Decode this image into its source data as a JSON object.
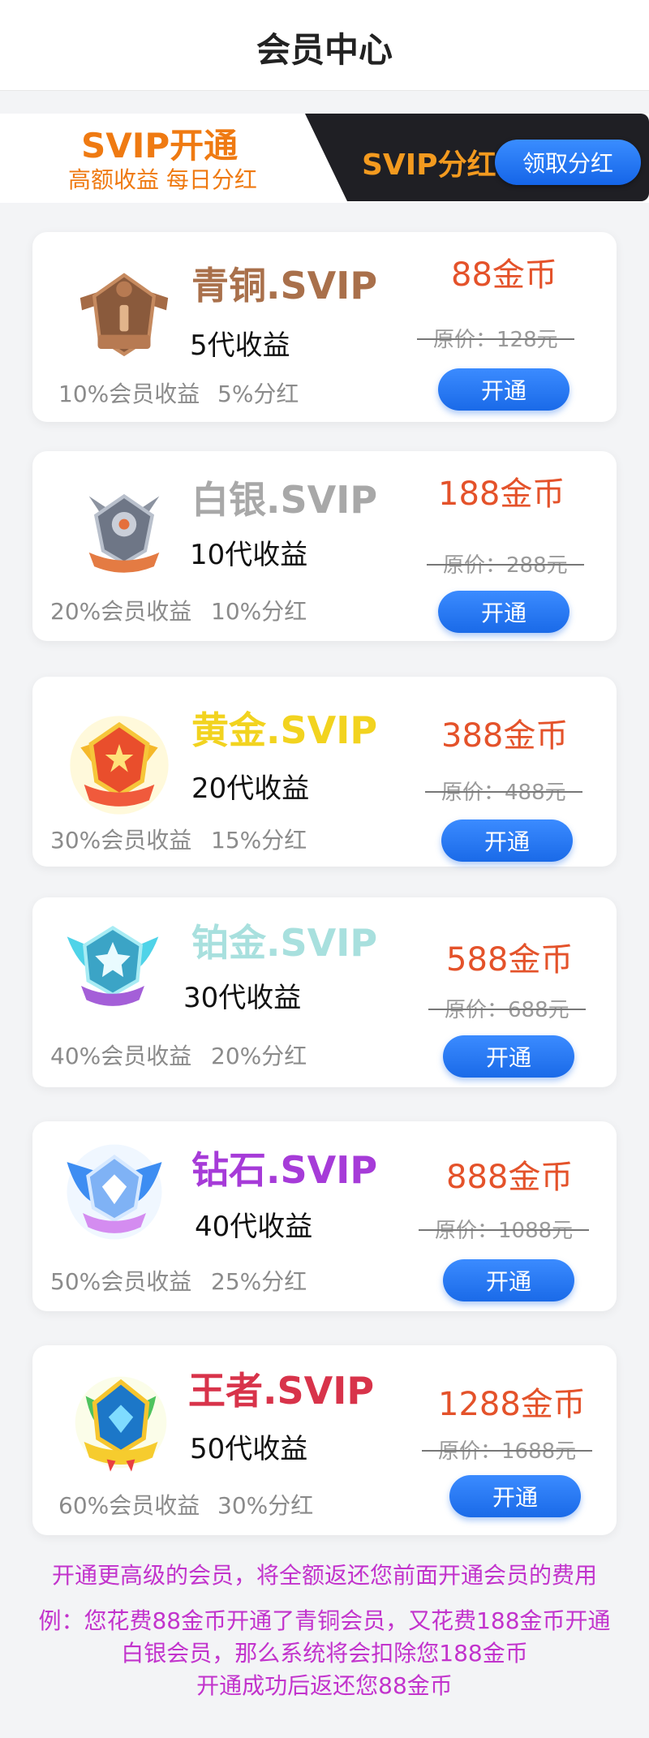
{
  "header": {
    "title": "会员中心"
  },
  "banner": {
    "title": "SVIP开通",
    "subtitle": "高额收益 每日分红",
    "dividend_label": "SVIP分红",
    "claim_button": "领取分红"
  },
  "tiers": [
    {
      "name": "青铜.SVIP",
      "generations": "5代收益",
      "member_income": "10%会员收益",
      "dividend": "5%分红",
      "price": "88金币",
      "original_price": "原价：128元",
      "open_button": "开通",
      "name_color": "#a9704b",
      "badge": "bronze-badge-icon"
    },
    {
      "name": "白银.SVIP",
      "generations": "10代收益",
      "member_income": "20%会员收益",
      "dividend": "10%分红",
      "price": "188金币",
      "original_price": "原价：288元",
      "open_button": "开通",
      "name_color": "#a8a8a8",
      "badge": "silver-badge-icon"
    },
    {
      "name": "黄金.SVIP",
      "generations": "20代收益",
      "member_income": "30%会员收益",
      "dividend": "15%分红",
      "price": "388金币",
      "original_price": "原价：488元",
      "open_button": "开通",
      "name_color": "#f2d31f",
      "badge": "gold-badge-icon"
    },
    {
      "name": "铂金.SVIP",
      "generations": "30代收益",
      "member_income": "40%会员收益",
      "dividend": "20%分红",
      "price": "588金币",
      "original_price": "原价：688元",
      "open_button": "开通",
      "name_color": "#a8e0de",
      "badge": "platinum-badge-icon"
    },
    {
      "name": "钻石.SVIP",
      "generations": "40代收益",
      "member_income": "50%会员收益",
      "dividend": "25%分红",
      "price": "888金币",
      "original_price": "原价：1088元",
      "open_button": "开通",
      "name_color": "#a63bd8",
      "badge": "diamond-badge-icon"
    },
    {
      "name": "王者.SVIP",
      "generations": "50代收益",
      "member_income": "60%会员收益",
      "dividend": "30%分红",
      "price": "1288金币",
      "original_price": "原价：1688元",
      "open_button": "开通",
      "name_color": "#d8334a",
      "badge": "king-badge-icon"
    }
  ],
  "notes": {
    "line1": "开通更高级的会员，将全额返还您前面开通会员的费用",
    "line2": "例：您花费88金币开通了青铜会员，又花费188金币开通",
    "line3": "白银会员，那么系统将会扣除您188金币",
    "line4": "开通成功后返还您88金币"
  },
  "colors": {
    "accent_orange": "#ef7a12",
    "button_blue": "#1a6ae8",
    "price_red": "#e4522a",
    "note_purple": "#c233cc"
  }
}
